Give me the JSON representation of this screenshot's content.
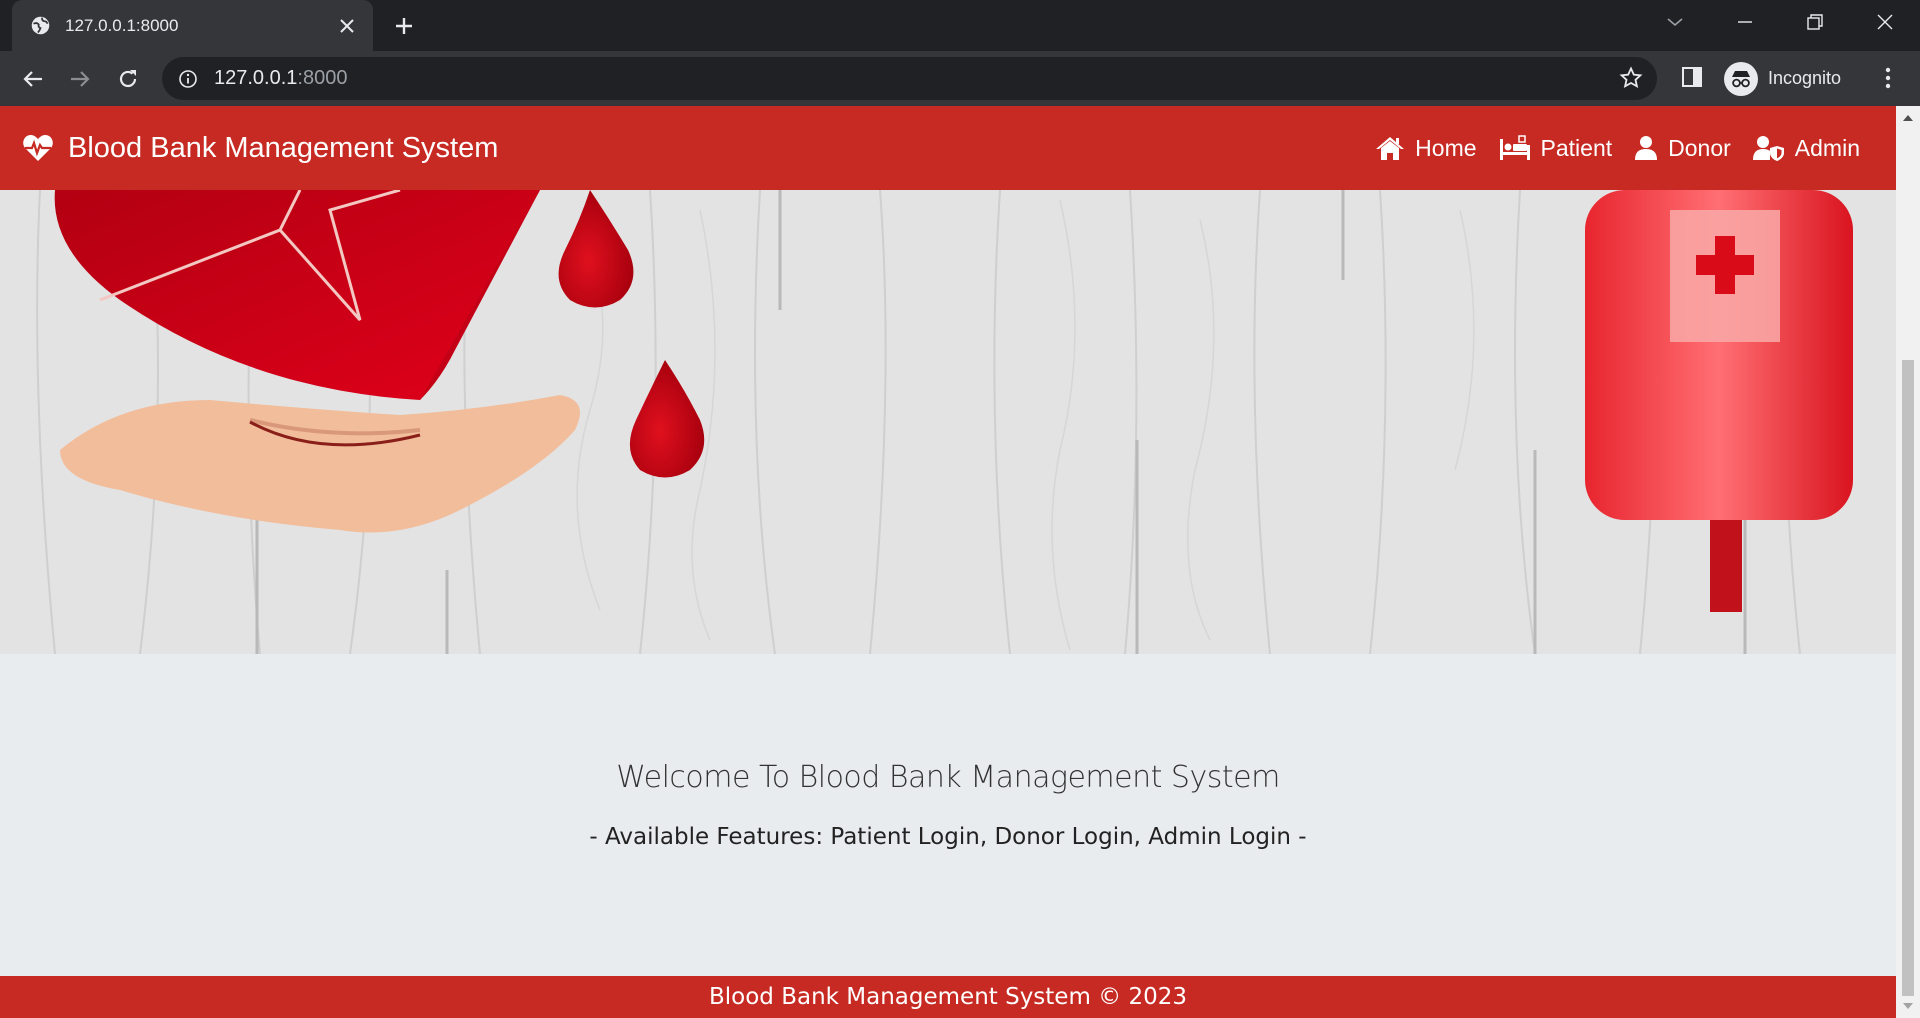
{
  "browser": {
    "tab_title": "127.0.0.1:8000",
    "url_host": "127.0.0.1",
    "url_port": ":8000",
    "profile_label": "Incognito"
  },
  "site": {
    "brand": "Blood Bank Management System",
    "menu": [
      {
        "label": "Home",
        "icon": "home-icon"
      },
      {
        "label": "Patient",
        "icon": "bed-icon"
      },
      {
        "label": "Donor",
        "icon": "user-icon"
      },
      {
        "label": "Admin",
        "icon": "user-shield-icon"
      }
    ]
  },
  "welcome": {
    "title": "Welcome To Blood Bank Management System",
    "subtitle": "- Available Features: Patient Login, Donor Login, Admin Login -"
  },
  "footer": {
    "text": "Blood Bank Management System © 2023"
  },
  "colors": {
    "brand_red": "#c62a22",
    "page_bg": "#e9ecef",
    "chrome_dark": "#202124"
  }
}
